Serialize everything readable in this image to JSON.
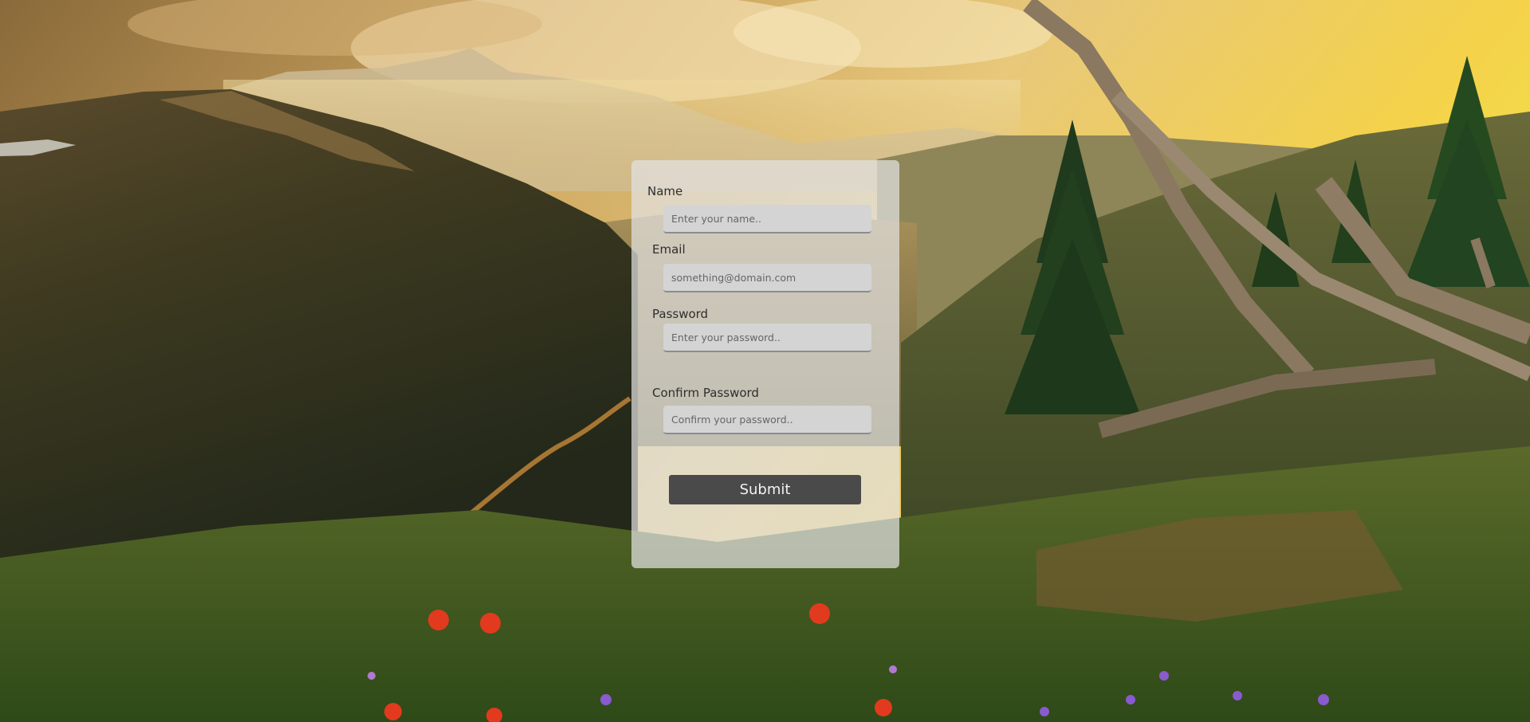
{
  "form": {
    "name": {
      "label": "Name",
      "placeholder": "Enter your name.."
    },
    "email": {
      "label": "Email",
      "placeholder": "something@domain.com"
    },
    "password": {
      "label": "Password",
      "placeholder": "Enter your password.."
    },
    "confirm_password": {
      "label": "Confirm Password",
      "placeholder": "Confirm your password.."
    },
    "submit_label": "Submit"
  },
  "colors": {
    "card_background": "#e2e2e2",
    "input_background": "#d4d4d4",
    "button_background": "#4a4a4a",
    "button_text": "#f2f2f2"
  },
  "background": {
    "description_icon": "mountain-landscape-photo"
  }
}
